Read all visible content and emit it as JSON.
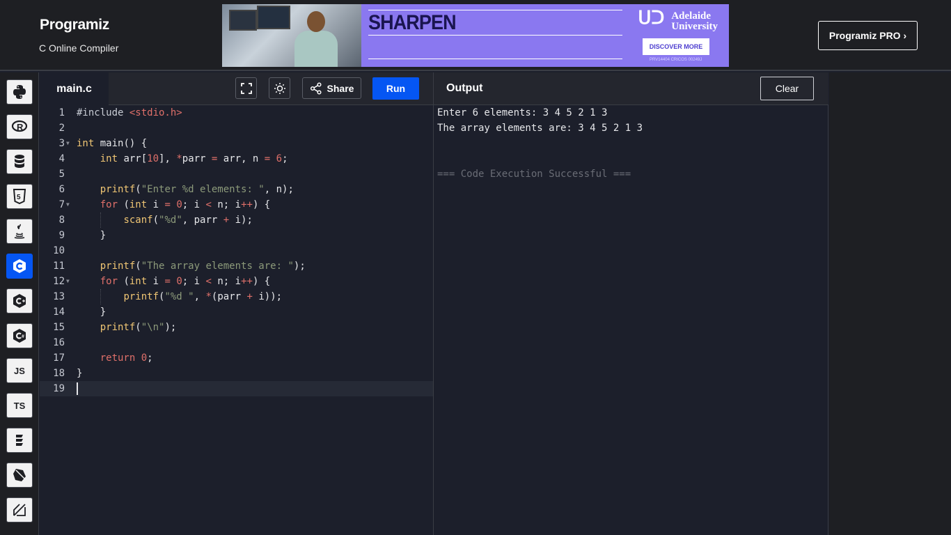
{
  "header": {
    "logo_text": "Programiz",
    "subtitle": "C Online Compiler",
    "pro_button": "Programiz PRO ›"
  },
  "ad": {
    "headline": "SHARPEN",
    "brand_line1": "Adelaide",
    "brand_line2": "University",
    "cta": "DISCOVER MORE",
    "fineprint": "PRV14404 CRICOS 00249J"
  },
  "sidebar": {
    "items": [
      {
        "name": "python",
        "icon": "python-icon"
      },
      {
        "name": "r",
        "icon": "r-icon",
        "label": "R"
      },
      {
        "name": "sql",
        "icon": "database-icon"
      },
      {
        "name": "html",
        "icon": "html5-icon",
        "label": "5"
      },
      {
        "name": "java",
        "icon": "java-icon"
      },
      {
        "name": "c",
        "icon": "c-icon",
        "label": "C",
        "active": true
      },
      {
        "name": "cpp",
        "icon": "cpp-icon",
        "label": "C"
      },
      {
        "name": "csharp",
        "icon": "csharp-icon",
        "label": "C"
      },
      {
        "name": "javascript",
        "label": "JS"
      },
      {
        "name": "typescript",
        "label": "TS"
      },
      {
        "name": "swift",
        "icon": "swift-icon"
      },
      {
        "name": "dart",
        "icon": "dart-icon"
      },
      {
        "name": "kotlin",
        "icon": "kotlin-icon"
      }
    ]
  },
  "editor": {
    "tab_label": "main.c",
    "share_label": "Share",
    "run_label": "Run",
    "lines": [
      "1",
      "2",
      "3",
      "4",
      "5",
      "6",
      "7",
      "8",
      "9",
      "10",
      "11",
      "12",
      "13",
      "14",
      "15",
      "16",
      "17",
      "18",
      "19"
    ]
  },
  "output": {
    "title": "Output",
    "clear_label": "Clear",
    "lines": [
      "Enter 6 elements: 3 4 5 2 1 3",
      "The array elements are: 3 4 5 2 1 3",
      "",
      "",
      "=== Code Execution Successful ==="
    ]
  },
  "colors": {
    "accent": "#0556f3",
    "keyword": "#f0c674",
    "string": "#8c9a7a",
    "number": "#e0706a",
    "operator": "#e0706a",
    "include_header": "#e0706a"
  }
}
